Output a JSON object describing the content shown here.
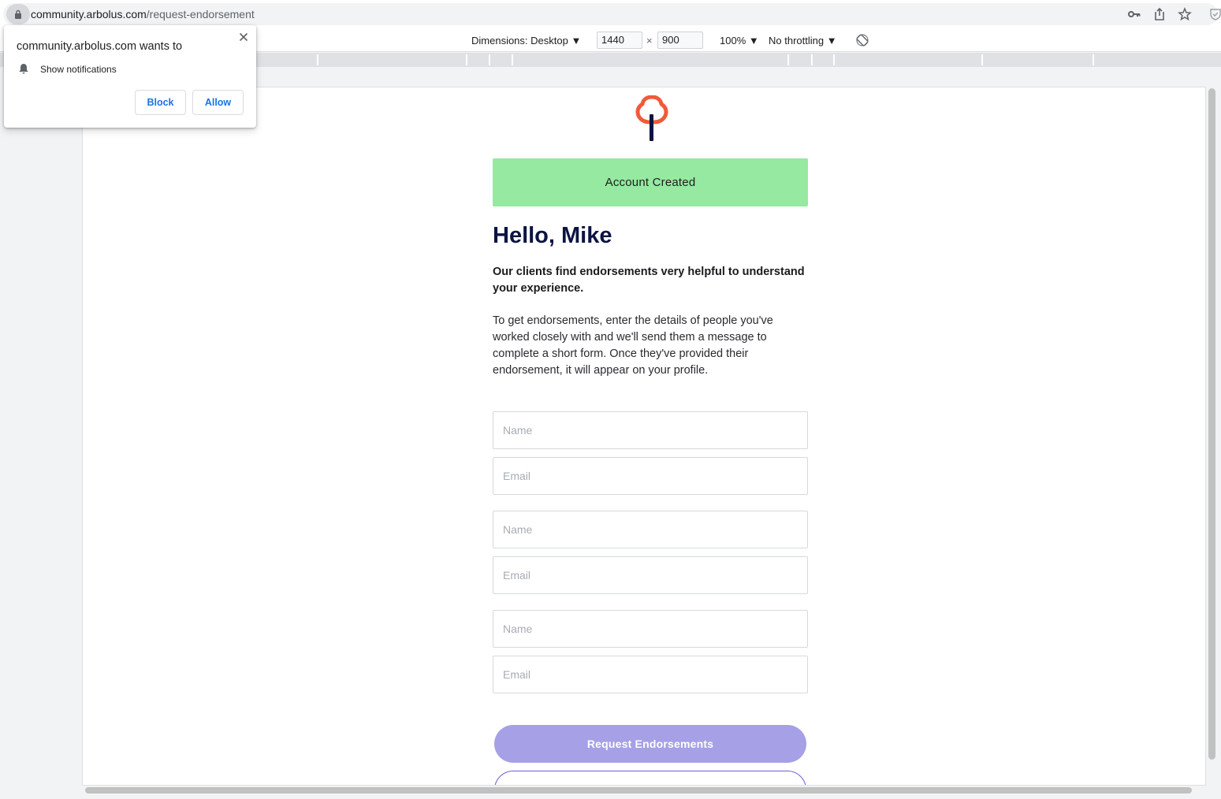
{
  "browser": {
    "url_host": "community.arbolus.com",
    "url_path": "/request-endorsement"
  },
  "devtools": {
    "dimensions_label": "Dimensions: Desktop ▼",
    "width": "1440",
    "times": "×",
    "height": "900",
    "zoom": "100% ▼",
    "throttling": "No throttling ▼"
  },
  "popup": {
    "title": "community.arbolus.com wants to",
    "permission": "Show notifications",
    "block_label": "Block",
    "allow_label": "Allow"
  },
  "page": {
    "toast": "Account Created",
    "greeting": "Hello, Mike",
    "lead": "Our clients find endorsements very helpful to understand your experience.",
    "body": "To get endorsements, enter the details of people you've worked closely with and we'll send them a message to complete a short form. Once they've provided their endorsement, it will appear on your profile.",
    "endorsers": [
      {
        "name_placeholder": "Name",
        "email_placeholder": "Email"
      },
      {
        "name_placeholder": "Name",
        "email_placeholder": "Email"
      },
      {
        "name_placeholder": "Name",
        "email_placeholder": "Email"
      }
    ],
    "request_button": "Request Endorsements",
    "secondary_button": ""
  },
  "colors": {
    "toast_bg": "#95e9a0",
    "heading": "#0c1442",
    "primary_button": "#a6a0e6",
    "logo_orange": "#f05a3a",
    "logo_navy": "#0c1442",
    "popup_button_text": "#1a73e8"
  },
  "icons": {
    "address_bar": [
      "lock-icon",
      "key-icon",
      "share-icon",
      "star-icon",
      "shield-icon"
    ],
    "devtools": [
      "rotate-icon"
    ],
    "popup": [
      "close-icon",
      "bell-icon"
    ]
  }
}
